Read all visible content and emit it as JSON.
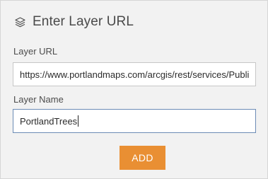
{
  "header": {
    "title": "Enter Layer URL",
    "icon": "layers-icon"
  },
  "layer_url": {
    "label": "Layer URL",
    "value": "https://www.portlandmaps.com/arcgis/rest/services/Public"
  },
  "layer_name": {
    "label": "Layer Name",
    "value": "PortlandTrees"
  },
  "actions": {
    "add_label": "ADD"
  },
  "colors": {
    "accent": "#e98f33",
    "focus_border": "#6b8bb5"
  }
}
